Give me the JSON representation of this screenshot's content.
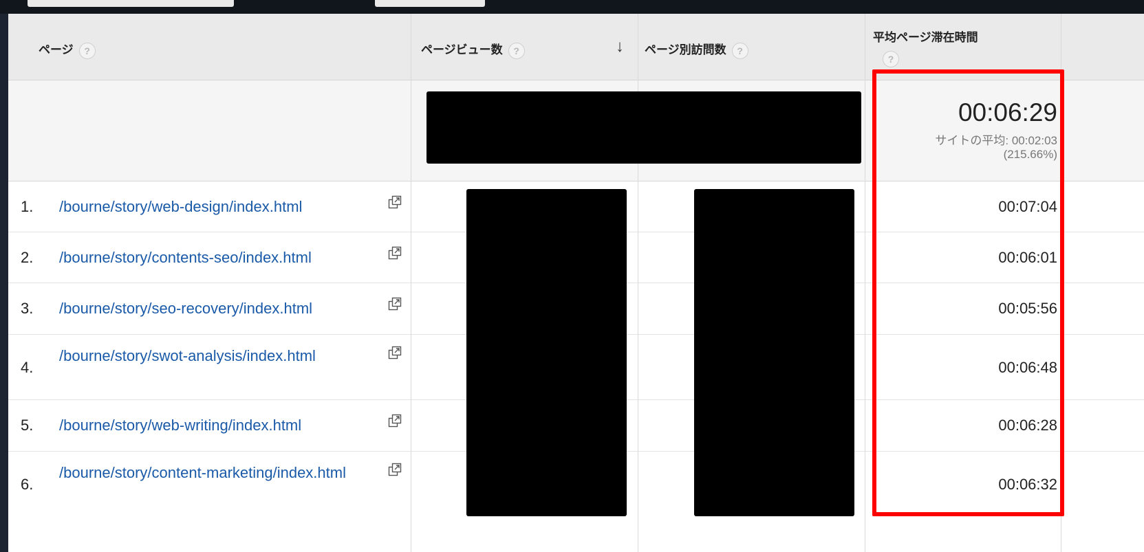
{
  "columns": {
    "page": "ページ",
    "pageviews": "ページビュー数",
    "unique_pageviews": "ページ別訪問数",
    "avg_time": "平均ページ滞在時間",
    "help_glyph": "?"
  },
  "summary": {
    "avg_time": "00:06:29",
    "site_avg": "サイトの平均: 00:02:03",
    "site_pct": "(215.66%)"
  },
  "rows": [
    {
      "num": "1.",
      "page": "/bourne/story/web-design/index.html",
      "avg_time": "00:07:04"
    },
    {
      "num": "2.",
      "page": "/bourne/story/contents-seo/index.html",
      "avg_time": "00:06:01"
    },
    {
      "num": "3.",
      "page": "/bourne/story/seo-recovery/index.html",
      "avg_time": "00:05:56"
    },
    {
      "num": "4.",
      "page": "/bourne/story/swot-analysis/index.html",
      "avg_time": "00:06:48"
    },
    {
      "num": "5.",
      "page": "/bourne/story/web-writing/index.html",
      "avg_time": "00:06:28"
    },
    {
      "num": "6.",
      "page": "/bourne/story/content-marketing/index.html",
      "avg_time": "00:06:32"
    }
  ],
  "colors": {
    "link": "#1a5aa8",
    "highlight": "#ff0000"
  }
}
